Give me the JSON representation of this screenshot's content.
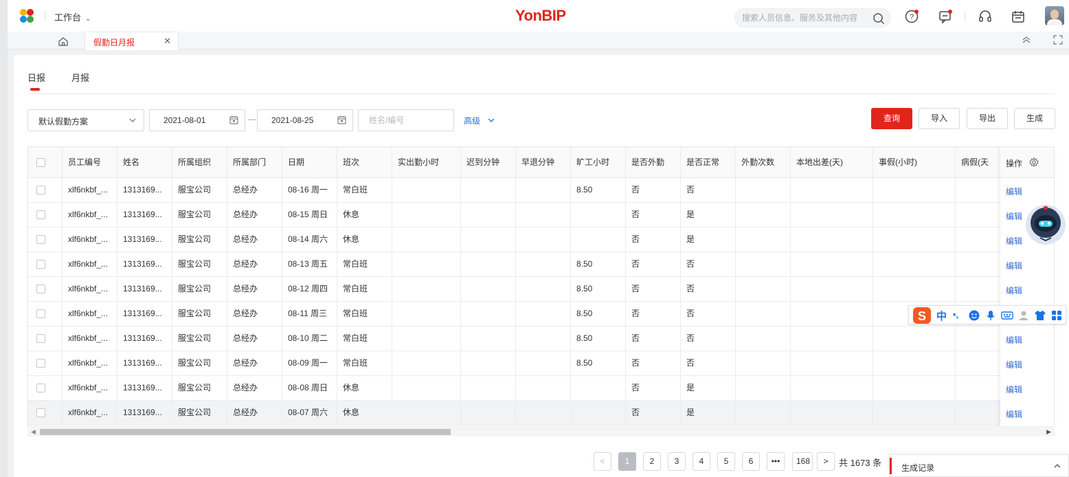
{
  "header": {
    "workbench": "工作台",
    "brand_yon": "Yon",
    "brand_bip": "BIP",
    "search_placeholder": "搜索人员信息、服务及其他内容",
    "icons": [
      "help-icon",
      "message-icon",
      "headset-icon",
      "calendar-icon"
    ]
  },
  "tabs": {
    "active_label": "假勤日月报"
  },
  "subtabs": {
    "daily": "日报",
    "monthly": "月报"
  },
  "filters": {
    "scheme": "默认假勤方案",
    "date_from": "2021-08-01",
    "date_sep": "—",
    "date_to": "2021-08-25",
    "name_placeholder": "姓名/编号",
    "advanced": "高级"
  },
  "actions": {
    "query": "查询",
    "import": "导入",
    "export": "导出",
    "generate": "生成"
  },
  "table": {
    "headers": [
      "员工编号",
      "姓名",
      "所属组织",
      "所属部门",
      "日期",
      "班次",
      "实出勤小时",
      "迟到分钟",
      "早退分钟",
      "旷工小时",
      "是否外勤",
      "是否正常",
      "外勤次数",
      "本地出差(天)",
      "事假(小时)",
      "病假(天"
    ],
    "ops_header": "操作",
    "edit_label": "编辑",
    "rows": [
      [
        "xlf6nkbf_...",
        "1313169...",
        "服宝公司",
        "总经办",
        "08-16 周一",
        "常白班",
        "",
        "",
        "",
        "8.50",
        "否",
        "否",
        "",
        "",
        "",
        ""
      ],
      [
        "xlf6nkbf_...",
        "1313169...",
        "服宝公司",
        "总经办",
        "08-15 周日",
        "休息",
        "",
        "",
        "",
        "",
        "否",
        "是",
        "",
        "",
        "",
        ""
      ],
      [
        "xlf6nkbf_...",
        "1313169...",
        "服宝公司",
        "总经办",
        "08-14 周六",
        "休息",
        "",
        "",
        "",
        "",
        "否",
        "是",
        "",
        "",
        "",
        ""
      ],
      [
        "xlf6nkbf_...",
        "1313169...",
        "服宝公司",
        "总经办",
        "08-13 周五",
        "常白班",
        "",
        "",
        "",
        "8.50",
        "否",
        "否",
        "",
        "",
        "",
        ""
      ],
      [
        "xlf6nkbf_...",
        "1313169...",
        "服宝公司",
        "总经办",
        "08-12 周四",
        "常白班",
        "",
        "",
        "",
        "8.50",
        "否",
        "否",
        "",
        "",
        "",
        ""
      ],
      [
        "xlf6nkbf_...",
        "1313169...",
        "服宝公司",
        "总经办",
        "08-11 周三",
        "常白班",
        "",
        "",
        "",
        "8.50",
        "否",
        "否",
        "",
        "",
        "",
        ""
      ],
      [
        "xlf6nkbf_...",
        "1313169...",
        "服宝公司",
        "总经办",
        "08-10 周二",
        "常白班",
        "",
        "",
        "",
        "8.50",
        "否",
        "否",
        "",
        "",
        "",
        ""
      ],
      [
        "xlf6nkbf_...",
        "1313169...",
        "服宝公司",
        "总经办",
        "08-09 周一",
        "常白班",
        "",
        "",
        "",
        "8.50",
        "否",
        "否",
        "",
        "",
        "",
        ""
      ],
      [
        "xlf6nkbf_...",
        "1313169...",
        "服宝公司",
        "总经办",
        "08-08 周日",
        "休息",
        "",
        "",
        "",
        "",
        "否",
        "是",
        "",
        "",
        "",
        ""
      ],
      [
        "xlf6nkbf_...",
        "1313169...",
        "服宝公司",
        "总经办",
        "08-07 周六",
        "休息",
        "",
        "",
        "",
        "",
        "否",
        "是",
        "",
        "",
        "",
        ""
      ]
    ],
    "selected_row_index": 9
  },
  "pagination": {
    "prev": "<",
    "pages": [
      "1",
      "2",
      "3",
      "4",
      "5",
      "6",
      "•••",
      "168"
    ],
    "current": "1",
    "next": ">",
    "total_text": "共 1673 条"
  },
  "gen_record": {
    "label": "生成记录"
  },
  "ime": {
    "mode": "中",
    "punct": "•,"
  },
  "colors": {
    "brand_red": "#e1251b",
    "link_blue": "#2e6cd5"
  }
}
